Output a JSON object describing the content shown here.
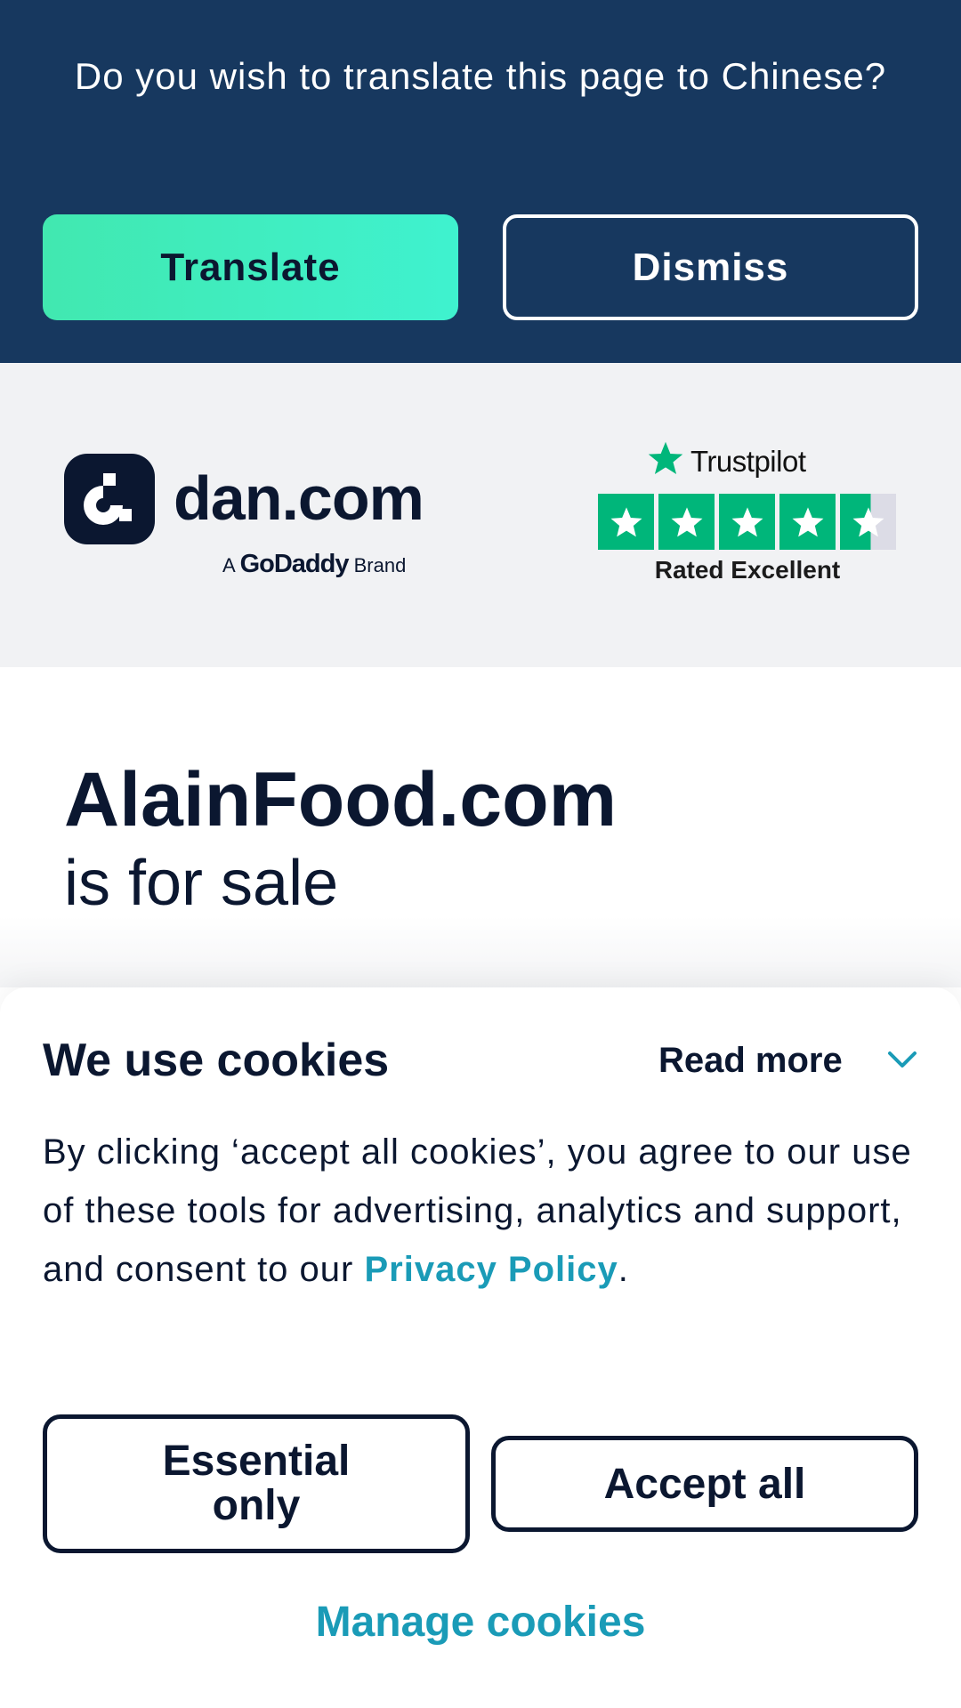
{
  "translate_banner": {
    "prompt": "Do you wish to translate this page to Chinese?",
    "translate_label": "Translate",
    "dismiss_label": "Dismiss"
  },
  "header": {
    "logo_text": "dan.com",
    "logo_sub_prefix": "A",
    "logo_sub_brand": "GoDaddy",
    "logo_sub_suffix": "Brand",
    "trustpilot_label": "Trustpilot",
    "trustpilot_rating_text": "Rated Excellent",
    "trustpilot_stars": 4.5,
    "icons": {
      "logo": "dan-logo-icon",
      "trustpilot": "star-icon"
    }
  },
  "listing": {
    "domain": "AlainFood.com",
    "status": "is for sale"
  },
  "cookies": {
    "title": "We use cookies",
    "read_more_label": "Read more",
    "body_text": "By clicking ‘accept all cookies’, you agree to our use of these tools for advertising, analytics and support, and consent to our ",
    "privacy_link_label": "Privacy Policy",
    "body_end": ".",
    "essential_label": "Essential only",
    "accept_label": "Accept all",
    "manage_label": "Manage cookies"
  },
  "colors": {
    "banner_bg": "#17385f",
    "translate_btn": "#3ff2cf",
    "trustpilot_green": "#00b67a",
    "link": "#1a9bb7",
    "text_dark": "#0b1730"
  }
}
